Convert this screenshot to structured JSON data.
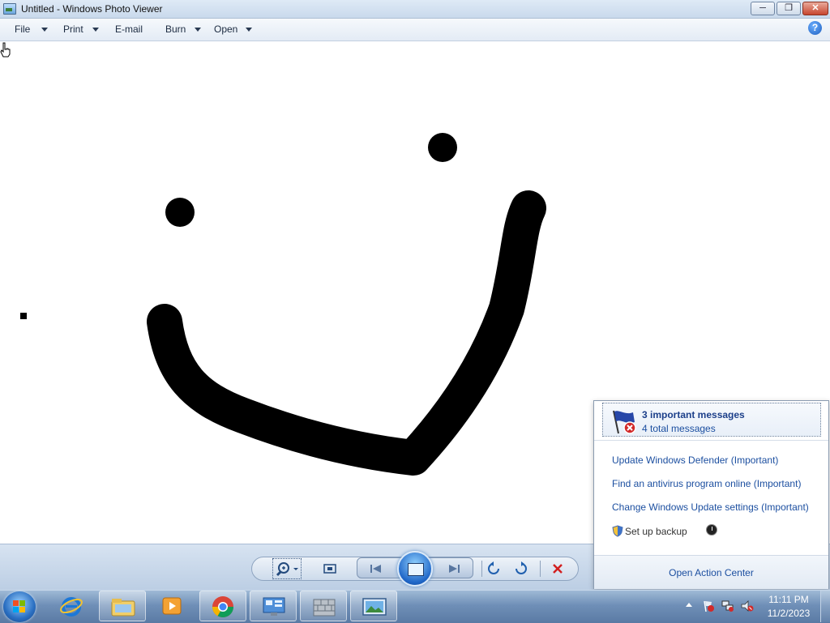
{
  "window": {
    "title": "Untitled - Windows Photo Viewer",
    "min_label": "─",
    "max_label": "❐",
    "close_label": "✕"
  },
  "menu": {
    "items": [
      {
        "label": "File"
      },
      {
        "label": "Print"
      },
      {
        "label": "E-mail"
      },
      {
        "label": "Burn"
      },
      {
        "label": "Open"
      }
    ],
    "help_label": "?"
  },
  "controls": {
    "zoom_icon": "magnifier-icon",
    "actual_size_icon": "fit-window-icon",
    "previous_icon": "skip-previous-icon",
    "slideshow_icon": "slideshow-icon",
    "next_icon": "skip-next-icon",
    "rotate_ccw_icon": "rotate-counterclockwise-icon",
    "rotate_cw_icon": "rotate-clockwise-icon",
    "delete_icon": "delete-x-icon"
  },
  "action_center": {
    "title": "3 important messages",
    "subtitle": "4 total messages",
    "links": [
      "Update Windows Defender (Important)",
      "Find an antivirus program online (Important)",
      "Change Windows Update settings (Important)"
    ],
    "backup_label": "Set up backup",
    "footer_label": "Open Action Center"
  },
  "taskbar": {
    "time": "11:11 PM",
    "date": "11/2/2023"
  },
  "colors": {
    "link": "#1c4fa0",
    "taskbar": "#6f8fb7",
    "delete": "#d21f1f"
  }
}
